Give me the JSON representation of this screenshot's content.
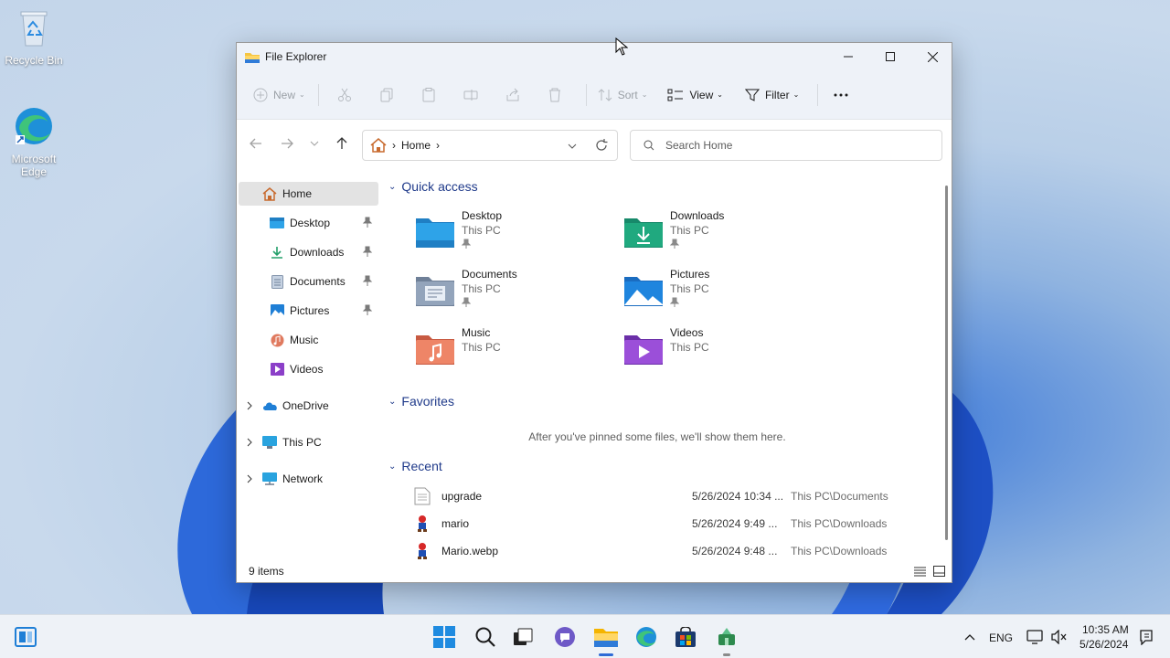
{
  "desktop": {
    "icons": [
      {
        "label": "Recycle Bin"
      },
      {
        "label": "Microsoft Edge"
      }
    ]
  },
  "window": {
    "title": "File Explorer",
    "toolbar": {
      "new_label": "New",
      "sort_label": "Sort",
      "view_label": "View",
      "filter_label": "Filter"
    },
    "address": {
      "crumb": "Home"
    },
    "search": {
      "placeholder": "Search Home"
    },
    "sidebar": {
      "items": [
        {
          "label": "Home",
          "icon": "home-icon"
        },
        {
          "label": "Desktop",
          "icon": "desktop-folder-icon",
          "pinned": true
        },
        {
          "label": "Downloads",
          "icon": "download-icon",
          "pinned": true
        },
        {
          "label": "Documents",
          "icon": "documents-icon",
          "pinned": true
        },
        {
          "label": "Pictures",
          "icon": "pictures-icon",
          "pinned": true
        },
        {
          "label": "Music",
          "icon": "music-icon"
        },
        {
          "label": "Videos",
          "icon": "videos-icon"
        },
        {
          "label": "OneDrive",
          "icon": "onedrive-icon"
        },
        {
          "label": "This PC",
          "icon": "monitor-icon"
        },
        {
          "label": "Network",
          "icon": "network-icon"
        }
      ]
    },
    "quick_access": {
      "heading": "Quick access",
      "items": [
        {
          "name": "Desktop",
          "location": "This PC",
          "pinned": true
        },
        {
          "name": "Downloads",
          "location": "This PC",
          "pinned": true
        },
        {
          "name": "Documents",
          "location": "This PC",
          "pinned": true
        },
        {
          "name": "Pictures",
          "location": "This PC",
          "pinned": true
        },
        {
          "name": "Music",
          "location": "This PC",
          "pinned": false
        },
        {
          "name": "Videos",
          "location": "This PC",
          "pinned": false
        }
      ]
    },
    "favorites": {
      "heading": "Favorites",
      "empty_message": "After you've pinned some files, we'll show them here."
    },
    "recent": {
      "heading": "Recent",
      "rows": [
        {
          "name": "upgrade",
          "date": "5/26/2024 10:34 ...",
          "location": "This PC\\Documents"
        },
        {
          "name": "mario",
          "date": "5/26/2024 9:49 ...",
          "location": "This PC\\Downloads"
        },
        {
          "name": "Mario.webp",
          "date": "5/26/2024 9:48 ...",
          "location": "This PC\\Downloads"
        }
      ]
    },
    "status": {
      "item_count": "9 items"
    }
  },
  "taskbar": {
    "language": "ENG",
    "time": "10:35 AM",
    "date": "5/26/2024"
  },
  "colors": {
    "accent": "#2f6bd6",
    "section_heading": "#1f3a8a",
    "window_chrome": "#eef2f8"
  }
}
